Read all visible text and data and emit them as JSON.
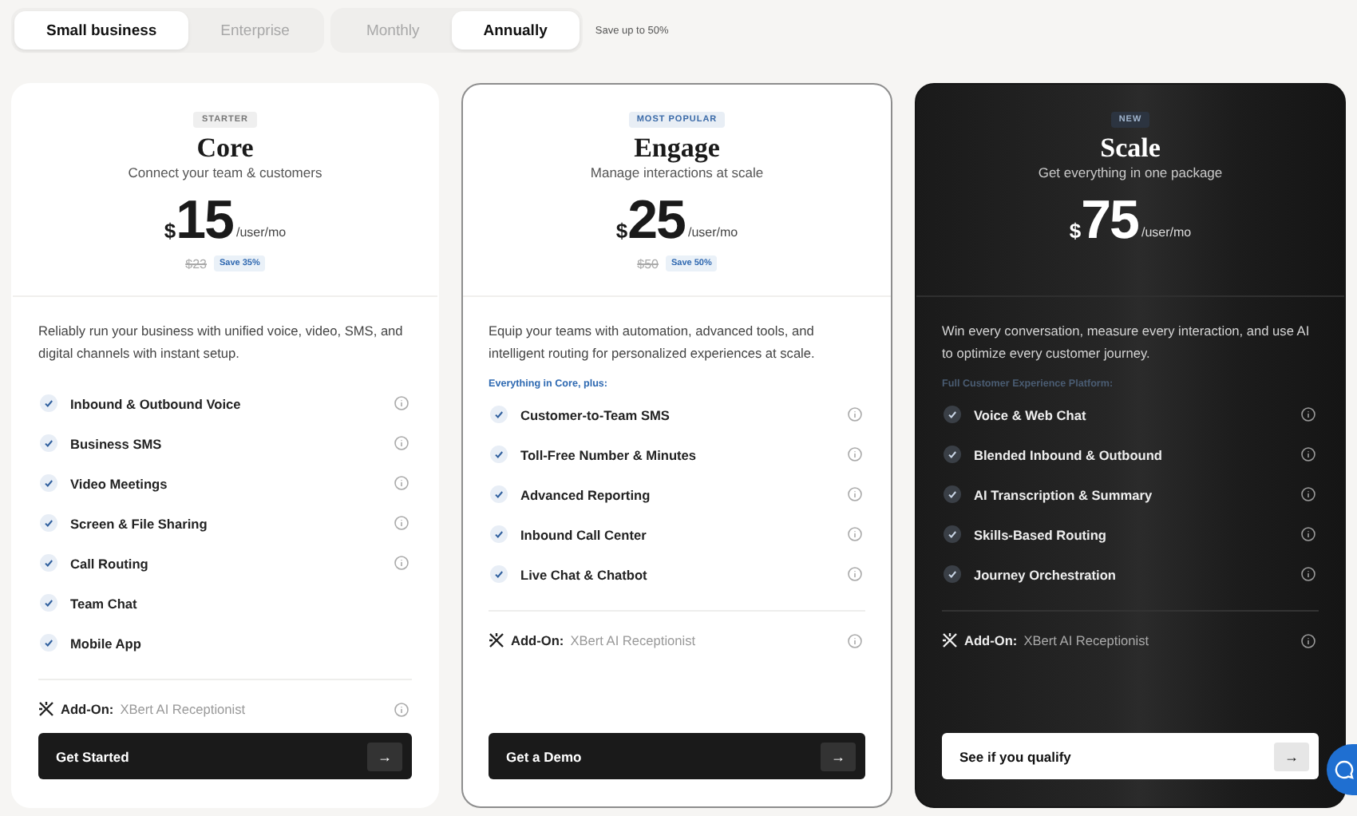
{
  "audience_toggle": [
    {
      "label": "Small business",
      "selected": true
    },
    {
      "label": "Enterprise",
      "selected": false
    }
  ],
  "billing_toggle": [
    {
      "label": "Monthly",
      "selected": false
    },
    {
      "label": "Annually",
      "selected": true
    }
  ],
  "billing_note": "Save up to 50%",
  "plans": [
    {
      "kind": "light",
      "badge": "STARTER",
      "name": "Core",
      "tagline": "Connect your team & customers",
      "currency": "$",
      "price": "15",
      "unit": "/user/mo",
      "old_price": "$23",
      "savings": "Save 35%",
      "description": "Reliably run your business with unified voice, video, SMS, and digital channels with instant setup.",
      "features": [
        {
          "label": "Inbound & Outbound Voice",
          "info": true
        },
        {
          "label": "Business SMS",
          "info": true
        },
        {
          "label": "Video Meetings",
          "info": true
        },
        {
          "label": "Screen & File Sharing",
          "info": true
        },
        {
          "label": "Call Routing",
          "info": true
        },
        {
          "label": "Team Chat",
          "info": false
        },
        {
          "label": "Mobile App",
          "info": false
        }
      ],
      "addon_label": "Add-On:",
      "addon_name": "XBert AI Receptionist",
      "cta": "Get Started",
      "cta_arrow": "→"
    },
    {
      "kind": "outlined",
      "badge": "MOST POPULAR",
      "name": "Engage",
      "tagline": "Manage interactions at scale",
      "currency": "$",
      "price": "25",
      "unit": "/user/mo",
      "old_price": "$50",
      "savings": "Save 50%",
      "description": "Equip your teams with automation, advanced tools, and intelligent routing for personalized experiences at scale.",
      "includes": "Everything in Core, plus:",
      "features": [
        {
          "label": "Customer-to-Team SMS",
          "info": true
        },
        {
          "label": "Toll-Free Number & Minutes",
          "info": true
        },
        {
          "label": "Advanced Reporting",
          "info": true
        },
        {
          "label": "Inbound Call Center",
          "info": true
        },
        {
          "label": "Live Chat & Chatbot",
          "info": true
        }
      ],
      "addon_label": "Add-On:",
      "addon_name": "XBert AI Receptionist",
      "cta": "Get a Demo",
      "cta_arrow": "→"
    },
    {
      "kind": "dark",
      "badge": "NEW",
      "name": "Scale",
      "tagline": "Get everything in one package",
      "currency": "$",
      "price": "75",
      "unit": "/user/mo",
      "description": "Win every conversation, measure every interaction, and use AI to optimize every customer journey.",
      "includes": "Full Customer Experience Platform:",
      "features": [
        {
          "label": "Voice & Web Chat",
          "info": true
        },
        {
          "label": "Blended Inbound & Outbound",
          "info": true
        },
        {
          "label": "AI Transcription & Summary",
          "info": true
        },
        {
          "label": "Skills-Based Routing",
          "info": true
        },
        {
          "label": "Journey Orchestration",
          "info": true
        }
      ],
      "addon_label": "Add-On:",
      "addon_name": "XBert AI Receptionist",
      "cta": "See if you qualify",
      "cta_arrow": "→"
    }
  ]
}
